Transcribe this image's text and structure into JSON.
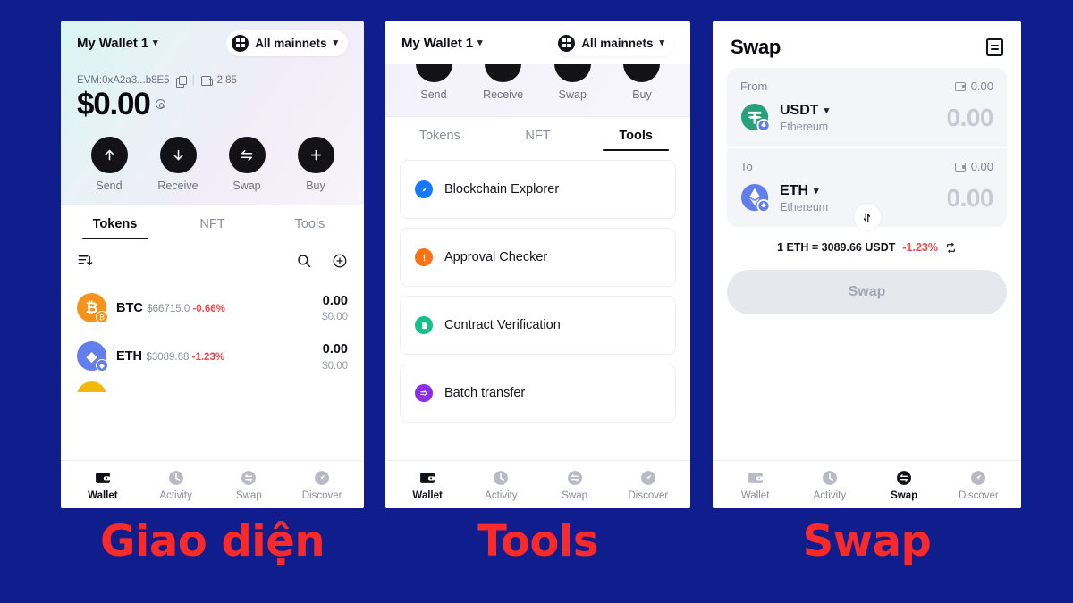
{
  "background_color": "#101d8c",
  "accent_red": "#fb2a2a",
  "panels": {
    "wallet": {
      "wallet_name": "My Wallet 1",
      "network_label": "All mainnets",
      "address": "EVM:0xA2a3...b8E5",
      "gas_value": "2.85",
      "balance": "$0.00",
      "actions": [
        {
          "label": "Send",
          "icon": "arrow-up-icon"
        },
        {
          "label": "Receive",
          "icon": "arrow-down-icon"
        },
        {
          "label": "Swap",
          "icon": "swap-arrows-icon"
        },
        {
          "label": "Buy",
          "icon": "plus-icon"
        }
      ],
      "tabs": [
        {
          "label": "Tokens",
          "active": true
        },
        {
          "label": "NFT",
          "active": false
        },
        {
          "label": "Tools",
          "active": false
        }
      ],
      "list_controls": {
        "sort_icon": "sort-descending-icon",
        "search_icon": "search-icon",
        "add_icon": "plus-circle-icon"
      },
      "tokens": [
        {
          "symbol": "BTC",
          "price": "$66715.0",
          "change": "-0.66%",
          "amount": "0.00",
          "value": "$0.00",
          "color": "#f7931a",
          "glyph": "Ƀ",
          "badge_color": "#f7931a"
        },
        {
          "symbol": "ETH",
          "price": "$3089.68",
          "change": "-1.23%",
          "amount": "0.00",
          "value": "$0.00",
          "color": "#627eea",
          "glyph": "◆",
          "badge_color": "#627eea"
        }
      ]
    },
    "tools": {
      "wallet_name": "My Wallet 1",
      "network_label": "All mainnets",
      "actions": [
        {
          "label": "Send"
        },
        {
          "label": "Receive"
        },
        {
          "label": "Swap"
        },
        {
          "label": "Buy"
        }
      ],
      "tabs": [
        {
          "label": "Tokens",
          "active": false
        },
        {
          "label": "NFT",
          "active": false
        },
        {
          "label": "Tools",
          "active": true
        }
      ],
      "items": [
        {
          "label": "Blockchain Explorer",
          "color": "#1677ff",
          "icon": "compass-icon"
        },
        {
          "label": "Approval Checker",
          "color": "#f97game",
          "icon": "alert-icon"
        },
        {
          "label": "Contract Verification",
          "color": "#17c08a",
          "icon": "document-icon"
        },
        {
          "label": "Batch transfer",
          "color": "#8b2fe6",
          "icon": "fast-forward-icon"
        }
      ]
    },
    "swap": {
      "title": "Swap",
      "order_icon": "order-history-icon",
      "from": {
        "label": "From",
        "balance": "0.00",
        "token": "USDT",
        "network": "Ethereum",
        "amount": "0.00",
        "color": "#26a17b"
      },
      "to": {
        "label": "To",
        "balance": "0.00",
        "token": "ETH",
        "network": "Ethereum",
        "amount": "0.00",
        "color": "#627eea"
      },
      "flip_icon": "swap-vertical-icon",
      "rate": "1 ETH = 3089.66 USDT",
      "rate_change": "-1.23%",
      "refresh_icon": "refresh-icon",
      "cta_label": "Swap"
    }
  },
  "bottom_nav": [
    {
      "label": "Wallet",
      "icon": "wallet-icon"
    },
    {
      "label": "Activity",
      "icon": "clock-icon"
    },
    {
      "label": "Swap",
      "icon": "swap-circle-icon"
    },
    {
      "label": "Discover",
      "icon": "compass-send-icon"
    }
  ],
  "captions": {
    "one": "Giao diện",
    "two": "Tools",
    "three": "Swap"
  }
}
